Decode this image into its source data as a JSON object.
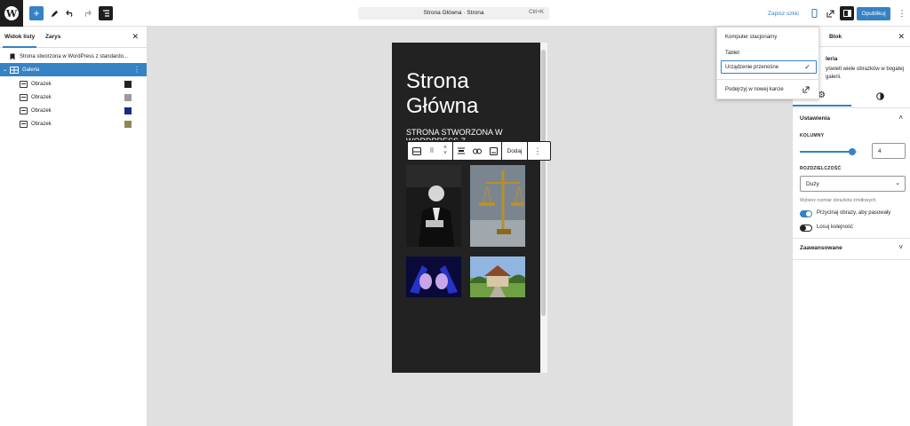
{
  "topbar": {
    "document_title": "Strona Główna · Strona",
    "shortcut": "Ctrl+K",
    "save_draft": "Zapisz szkic",
    "publish": "Opublikuj"
  },
  "left_panel": {
    "tabs": [
      "Widok listy",
      "Zarys"
    ],
    "items": [
      {
        "label": "Strona stworzona w WordPress z standardo..."
      },
      {
        "label": "Galeria"
      },
      {
        "label": "Obrazek"
      },
      {
        "label": "Obrazek"
      },
      {
        "label": "Obrazek"
      },
      {
        "label": "Obrazek"
      }
    ]
  },
  "canvas": {
    "site_title": "Strona Główna",
    "tagline": "STRONA STWORZONA W WORDPRESS Z",
    "toolbar_add": "Dodaj"
  },
  "device_menu": {
    "items": [
      "Komputer stacjonarny",
      "Tablet",
      "Urządzenie przenośne"
    ],
    "preview": "Podejrzyj w nowej karcie"
  },
  "right_panel": {
    "tab_block": "Blok",
    "block_desc_title": "leria",
    "block_desc": "yświetl wiele obrazków w bogatej galerii.",
    "settings_title": "Ustawienia",
    "columns_label": "KOLUMNY",
    "columns_value": "4",
    "columns_fraction": 0.9,
    "resolution_label": "ROZDZIELCZOŚĆ",
    "resolution_value": "Duży",
    "resolution_help": "Wybierz rozmiar obrazków źródłowych.",
    "crop_label": "Przycinaj obrazy, aby pasowały",
    "crop_on": true,
    "random_label": "Losuj kolejność",
    "random_on": false,
    "advanced_title": "Zaawansowane"
  },
  "colors": {
    "accent": "#3582c4",
    "dark": "#1e1e1e",
    "canvas_bg": "#e0e0e0"
  }
}
